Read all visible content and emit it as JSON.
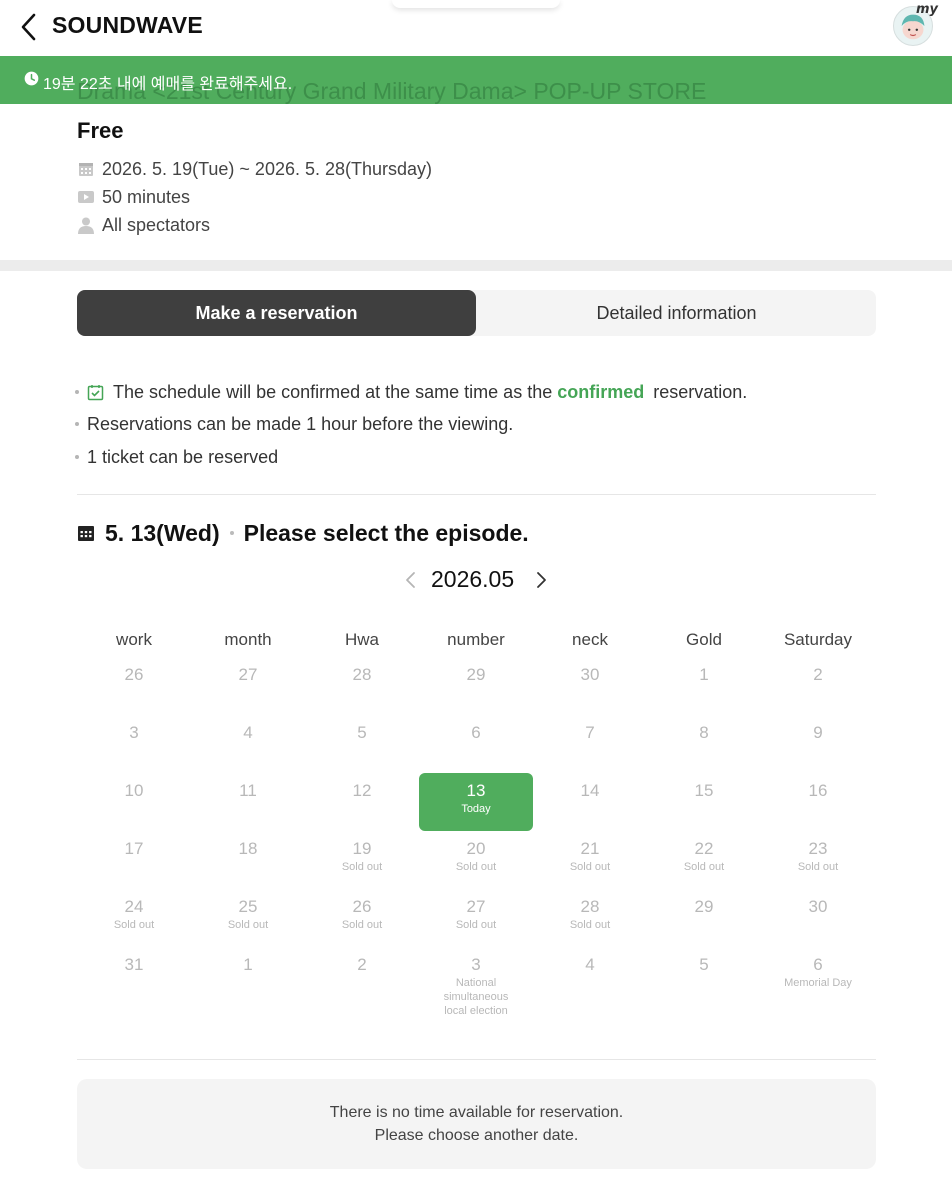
{
  "header": {
    "title": "SOUNDWAVE",
    "back_icon": "chevron-left-icon",
    "avatar_badge": "my"
  },
  "banner": {
    "text": "19분 22초 내에 예매를 완료해주세요.",
    "ghost_title": "Drama <21st Century Grand Military Dama> POP-UP STORE",
    "icon": "clock-icon",
    "color": "#50ad5d"
  },
  "event": {
    "price": "Free",
    "period": "2026. 5. 19(Tue) ~ 2026. 5. 28(Thursday)",
    "duration": "50 minutes",
    "audience": "All spectators"
  },
  "tabs": [
    {
      "label": "Make a reservation",
      "active": true
    },
    {
      "label": "Detailed information",
      "active": false
    }
  ],
  "notices": {
    "first_before": "The schedule will be confirmed at the same time as the",
    "first_highlight": "confirmed",
    "first_after": "reservation.",
    "second": "Reservations can be made 1 hour before the viewing.",
    "third": "1 ticket can be reserved"
  },
  "selection": {
    "date": "5. 13(Wed)",
    "prompt": "Please select the episode."
  },
  "calendar": {
    "month_label": "2026.05",
    "weekdays": [
      "work",
      "month",
      "Hwa",
      "number",
      "neck",
      "Gold",
      "Saturday"
    ],
    "weeks": [
      [
        {
          "n": "26",
          "s": ""
        },
        {
          "n": "27",
          "s": ""
        },
        {
          "n": "28",
          "s": ""
        },
        {
          "n": "29",
          "s": ""
        },
        {
          "n": "30",
          "s": ""
        },
        {
          "n": "1",
          "s": ""
        },
        {
          "n": "2",
          "s": ""
        }
      ],
      [
        {
          "n": "3",
          "s": ""
        },
        {
          "n": "4",
          "s": ""
        },
        {
          "n": "5",
          "s": ""
        },
        {
          "n": "6",
          "s": ""
        },
        {
          "n": "7",
          "s": ""
        },
        {
          "n": "8",
          "s": ""
        },
        {
          "n": "9",
          "s": ""
        }
      ],
      [
        {
          "n": "10",
          "s": ""
        },
        {
          "n": "11",
          "s": ""
        },
        {
          "n": "12",
          "s": ""
        },
        {
          "n": "13",
          "s": "Today",
          "selected": true
        },
        {
          "n": "14",
          "s": ""
        },
        {
          "n": "15",
          "s": ""
        },
        {
          "n": "16",
          "s": ""
        }
      ],
      [
        {
          "n": "17",
          "s": ""
        },
        {
          "n": "18",
          "s": ""
        },
        {
          "n": "19",
          "s": "Sold out"
        },
        {
          "n": "20",
          "s": "Sold out"
        },
        {
          "n": "21",
          "s": "Sold out"
        },
        {
          "n": "22",
          "s": "Sold out"
        },
        {
          "n": "23",
          "s": "Sold out"
        }
      ],
      [
        {
          "n": "24",
          "s": "Sold out"
        },
        {
          "n": "25",
          "s": "Sold out"
        },
        {
          "n": "26",
          "s": "Sold out"
        },
        {
          "n": "27",
          "s": "Sold out"
        },
        {
          "n": "28",
          "s": "Sold out"
        },
        {
          "n": "29",
          "s": ""
        },
        {
          "n": "30",
          "s": ""
        }
      ],
      [
        {
          "n": "31",
          "s": ""
        },
        {
          "n": "1",
          "s": ""
        },
        {
          "n": "2",
          "s": ""
        },
        {
          "n": "3",
          "s": "National simultaneous local election"
        },
        {
          "n": "4",
          "s": ""
        },
        {
          "n": "5",
          "s": ""
        },
        {
          "n": "6",
          "s": "Memorial Day"
        }
      ]
    ]
  },
  "empty_message": {
    "line1": "There is no time available for reservation.",
    "line2": "Please choose another date."
  }
}
